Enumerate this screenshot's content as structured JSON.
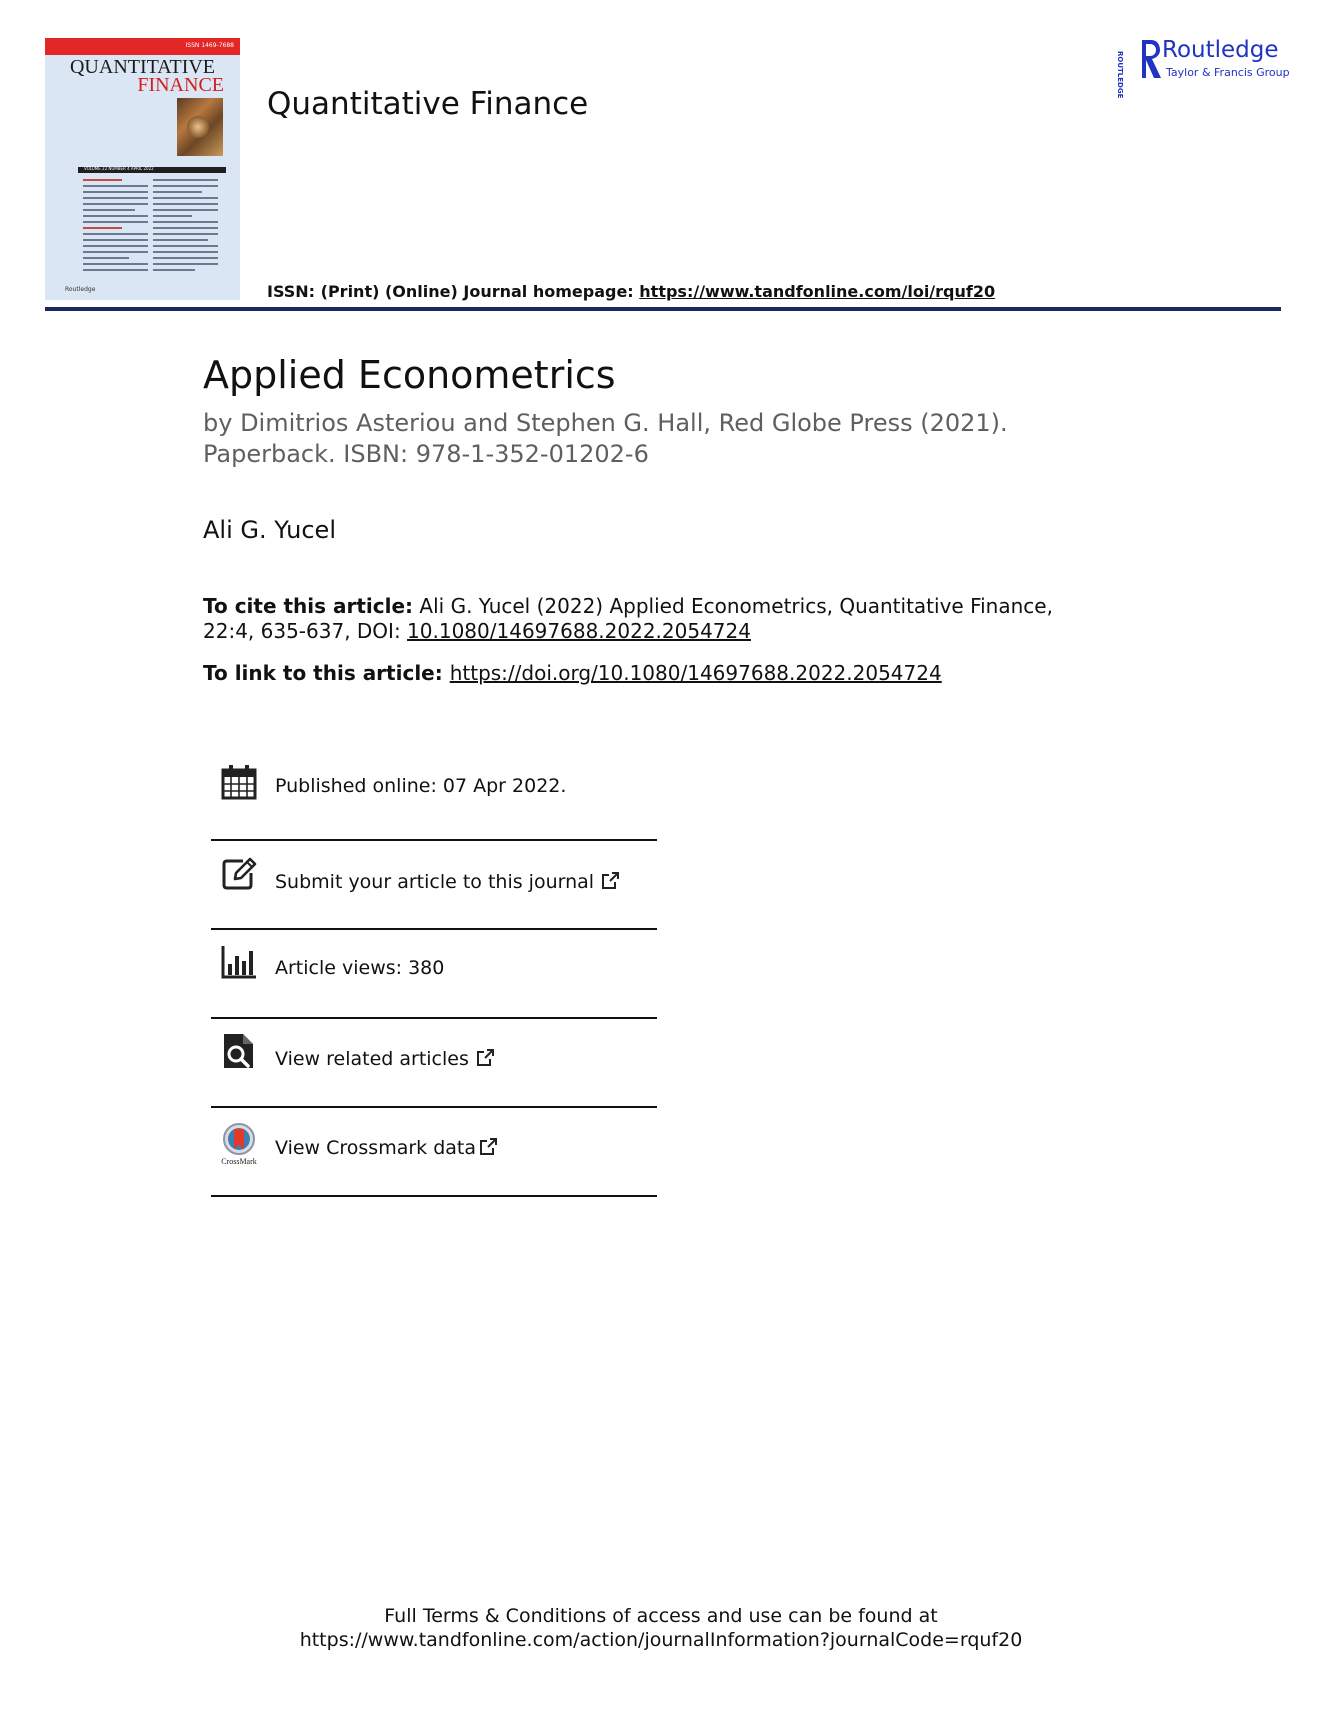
{
  "cover": {
    "issn": "ISSN 1469-7688",
    "title_line1": "QUANTITATIVE",
    "title_line2": "FINANCE",
    "volume_line": "VOLUME 22   NUMBER 4   APRIL 2022",
    "publisher_mark": "Routledge"
  },
  "header": {
    "journal_title": "Quantitative Finance",
    "issn_label": "ISSN: (Print) (Online) Journal homepage: ",
    "homepage_url": "https://www.tandfonline.com/loi/rquf20"
  },
  "publisher": {
    "vertical_text": "ROUTLEDGE",
    "name": "Routledge",
    "group": "Taylor & Francis Group"
  },
  "article": {
    "title": "Applied Econometrics",
    "subtitle_line1": "by Dimitrios Asteriou and Stephen G. Hall, Red Globe Press (2021).",
    "subtitle_line2": "Paperback. ISBN: 978-1-352-01202-6",
    "author": "Ali G. Yucel"
  },
  "citation": {
    "label": "To cite this article:",
    "text": " Ali G. Yucel (2022) Applied Econometrics, Quantitative Finance, 22:4, 635-637, DOI: ",
    "doi": "10.1080/14697688.2022.2054724",
    "link_label": "To link to this article: ",
    "link_url": "https://doi.org/10.1080/14697688.2022.2054724"
  },
  "info": {
    "published": "Published online: 07 Apr 2022.",
    "submit": "Submit your article to this journal",
    "views": "Article views: 380",
    "related": "View related articles",
    "crossmark": "View Crossmark data",
    "crossmark_logo_text": "CrossMark"
  },
  "footer": {
    "line1": "Full Terms & Conditions of access and use can be found at",
    "line2": "https://www.tandfonline.com/action/journalInformation?journalCode=rquf20"
  }
}
